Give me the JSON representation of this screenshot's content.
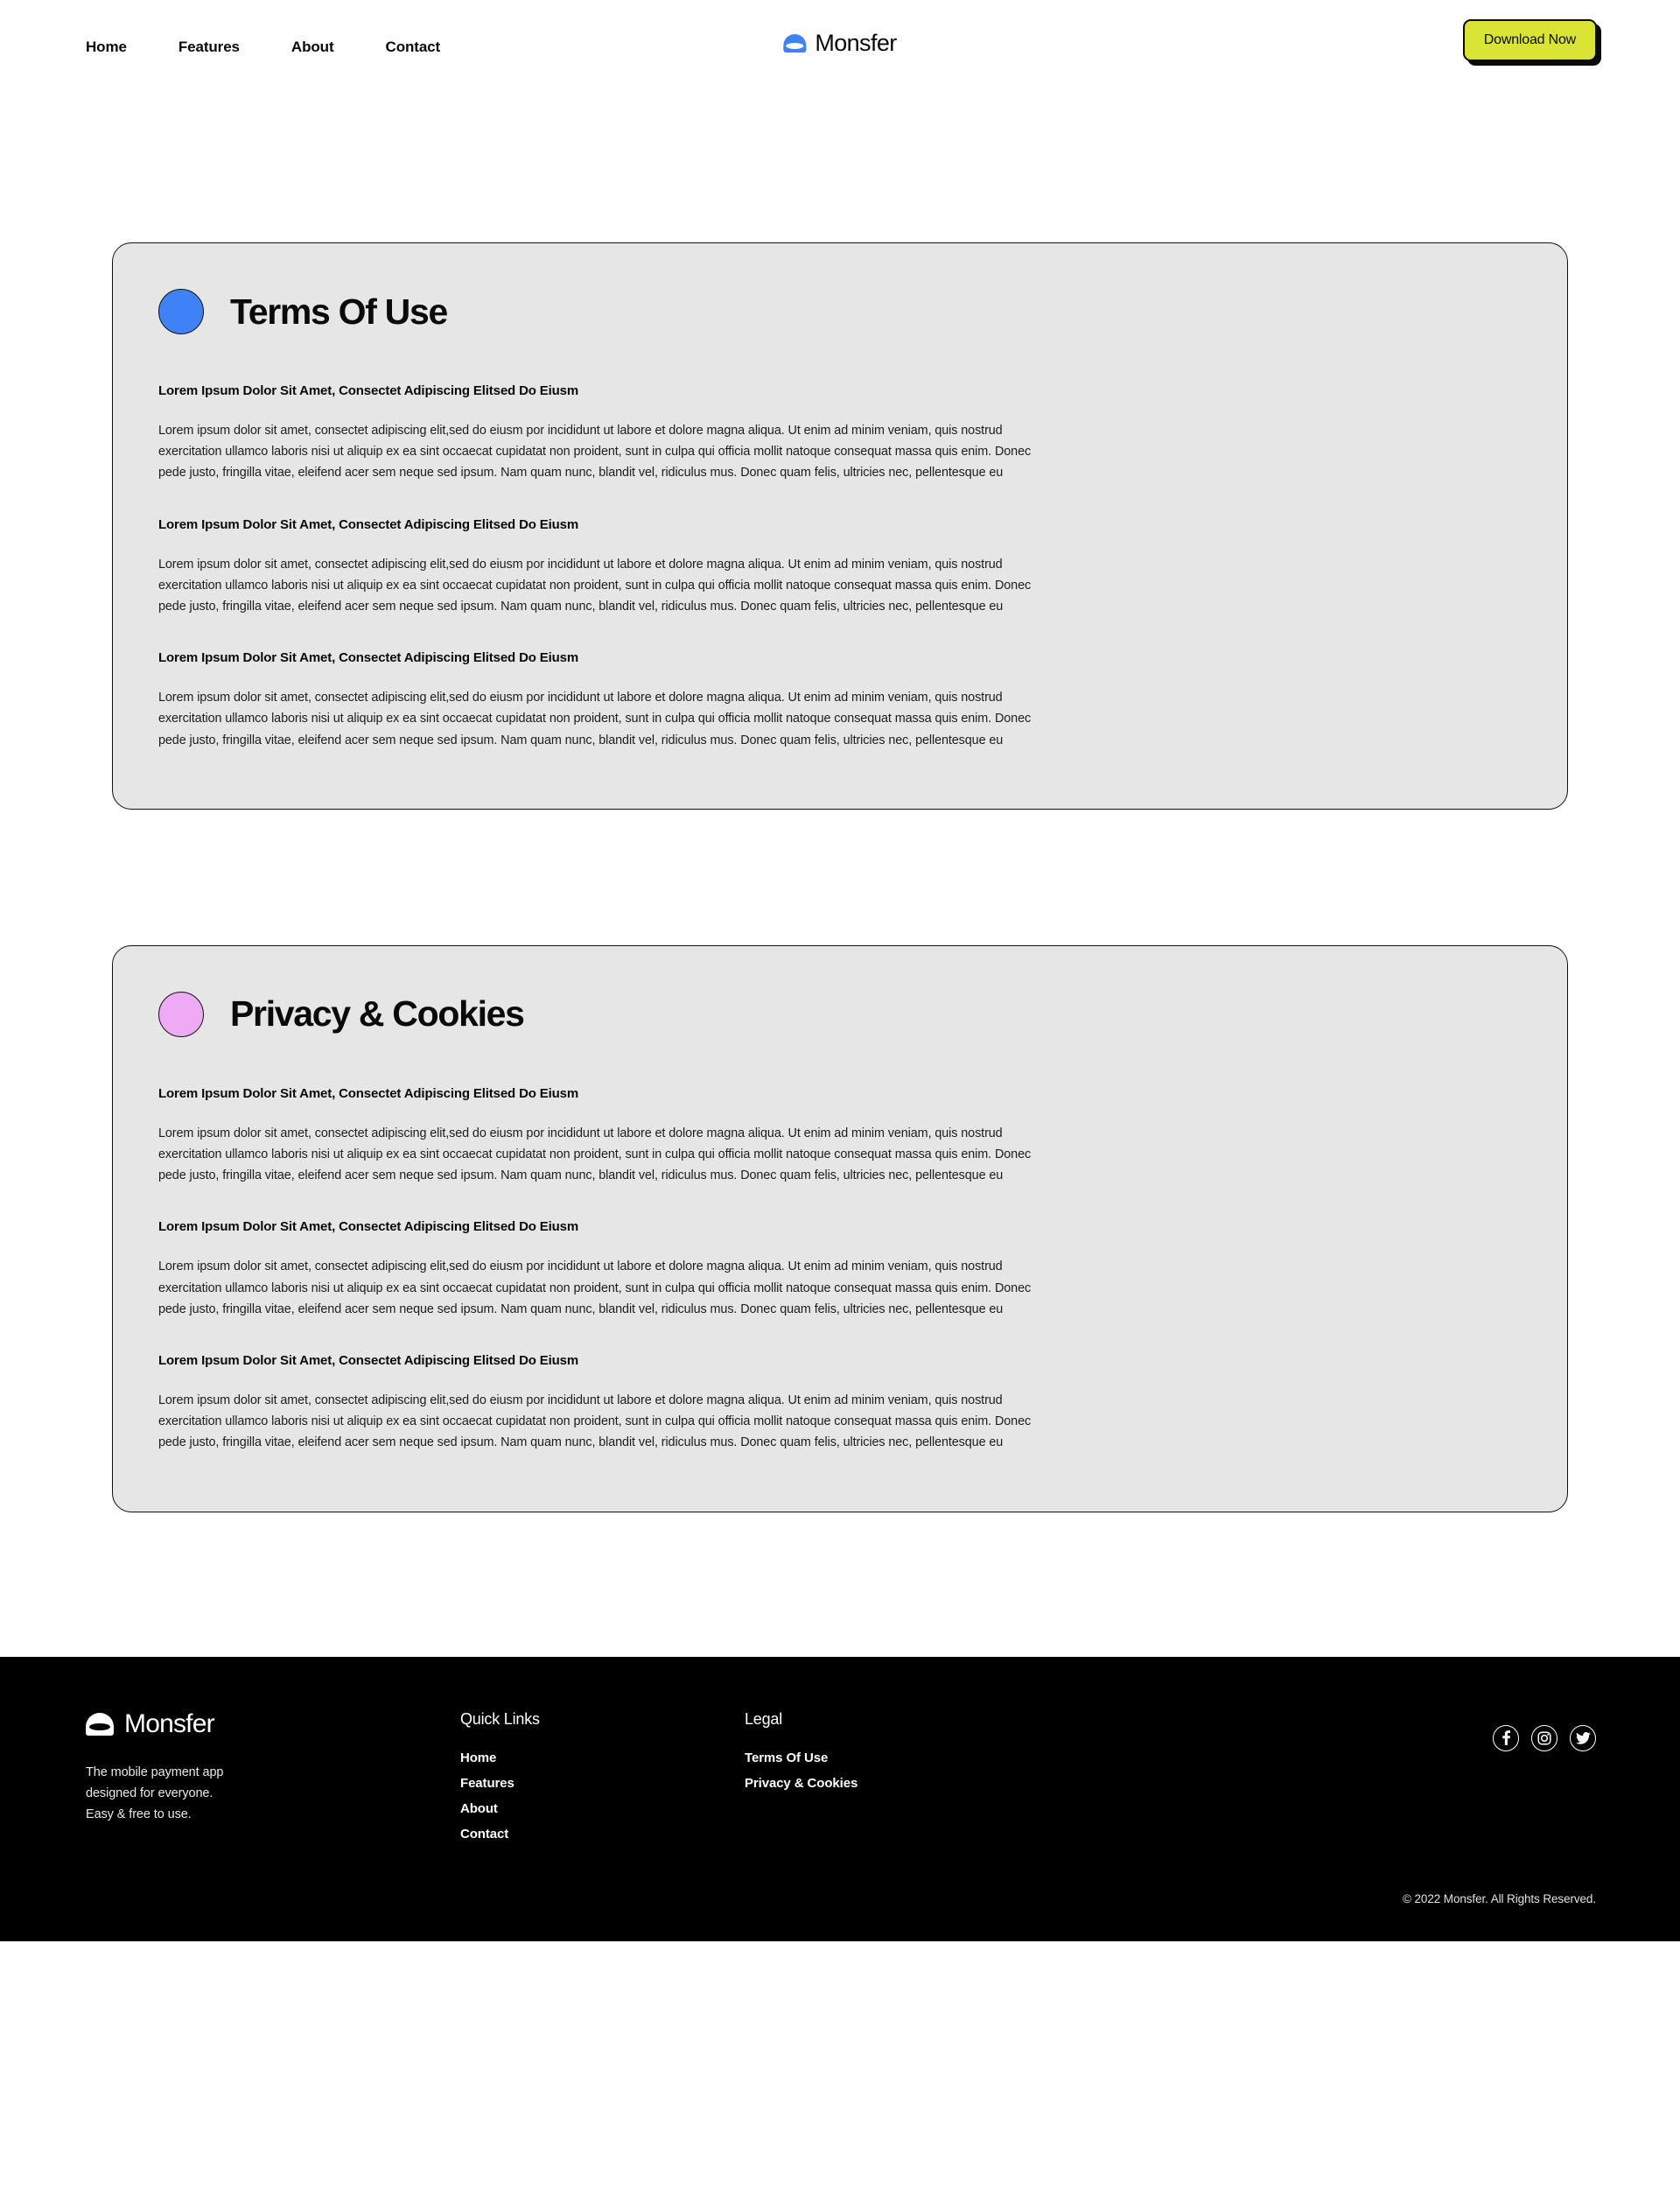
{
  "header": {
    "nav_items": [
      {
        "label": "Home"
      },
      {
        "label": "Features"
      },
      {
        "label": "About"
      },
      {
        "label": "Contact"
      }
    ],
    "brand_name": "Monsfer",
    "logo_icon": "monsfer-dome-logo",
    "cta_label": "Download Now",
    "cta_color": "#d9e434"
  },
  "cards": [
    {
      "title": "Terms Of Use",
      "dot_color": "#3f82f7",
      "blocks": [
        {
          "heading": "Lorem Ipsum Dolor Sit Amet, Consectet Adipiscing Elitsed Do Eiusm",
          "body": "Lorem ipsum dolor sit amet, consectet adipiscing elit,sed do eiusm por incididunt ut labore et dolore magna aliqua. Ut enim ad minim veniam, quis nostrud exercitation ullamco laboris nisi ut aliquip ex ea sint occaecat cupidatat non proident, sunt in culpa qui officia mollit natoque consequat massa quis enim. Donec pede justo, fringilla vitae, eleifend acer sem neque sed ipsum. Nam quam nunc, blandit vel, ridiculus mus. Donec quam felis, ultricies nec, pellentesque eu"
        },
        {
          "heading": "Lorem Ipsum Dolor Sit Amet, Consectet Adipiscing Elitsed Do Eiusm",
          "body": "Lorem ipsum dolor sit amet, consectet adipiscing elit,sed do eiusm por incididunt ut labore et dolore magna aliqua. Ut enim ad minim veniam, quis nostrud exercitation ullamco laboris nisi ut aliquip ex ea sint occaecat cupidatat non proident, sunt in culpa qui officia mollit natoque consequat massa quis enim. Donec pede justo, fringilla vitae, eleifend acer sem neque sed ipsum. Nam quam nunc, blandit vel, ridiculus mus. Donec quam felis, ultricies nec, pellentesque eu"
        },
        {
          "heading": "Lorem Ipsum Dolor Sit Amet, Consectet Adipiscing Elitsed Do Eiusm",
          "body": "Lorem ipsum dolor sit amet, consectet adipiscing elit,sed do eiusm por incididunt ut labore et dolore magna aliqua. Ut enim ad minim veniam, quis nostrud exercitation ullamco laboris nisi ut aliquip ex ea sint occaecat cupidatat non proident, sunt in culpa qui officia mollit natoque consequat massa quis enim. Donec pede justo, fringilla vitae, eleifend acer sem neque sed ipsum. Nam quam nunc, blandit vel, ridiculus mus. Donec quam felis, ultricies nec, pellentesque eu"
        }
      ]
    },
    {
      "title": "Privacy & Cookies",
      "dot_color": "#eeaaf5",
      "blocks": [
        {
          "heading": "Lorem Ipsum Dolor Sit Amet, Consectet Adipiscing Elitsed Do Eiusm",
          "body": "Lorem ipsum dolor sit amet, consectet adipiscing elit,sed do eiusm por incididunt ut labore et dolore magna aliqua. Ut enim ad minim veniam, quis nostrud exercitation ullamco laboris nisi ut aliquip ex ea sint occaecat cupidatat non proident, sunt in culpa qui officia mollit natoque consequat massa quis enim. Donec pede justo, fringilla vitae, eleifend acer sem neque sed ipsum. Nam quam nunc, blandit vel, ridiculus mus. Donec quam felis, ultricies nec, pellentesque eu"
        },
        {
          "heading": "Lorem Ipsum Dolor Sit Amet, Consectet Adipiscing Elitsed Do Eiusm",
          "body": "Lorem ipsum dolor sit amet, consectet adipiscing elit,sed do eiusm por incididunt ut labore et dolore magna aliqua. Ut enim ad minim veniam, quis nostrud exercitation ullamco laboris nisi ut aliquip ex ea sint occaecat cupidatat non proident, sunt in culpa qui officia mollit natoque consequat massa quis enim. Donec pede justo, fringilla vitae, eleifend acer sem neque sed ipsum. Nam quam nunc, blandit vel, ridiculus mus. Donec quam felis, ultricies nec, pellentesque eu"
        },
        {
          "heading": "Lorem Ipsum Dolor Sit Amet, Consectet Adipiscing Elitsed Do Eiusm",
          "body": "Lorem ipsum dolor sit amet, consectet adipiscing elit,sed do eiusm por incididunt ut labore et dolore magna aliqua. Ut enim ad minim veniam, quis nostrud exercitation ullamco laboris nisi ut aliquip ex ea sint occaecat cupidatat non proident, sunt in culpa qui officia mollit natoque consequat massa quis enim. Donec pede justo, fringilla vitae, eleifend acer sem neque sed ipsum. Nam quam nunc, blandit vel, ridiculus mus. Donec quam felis, ultricies nec, pellentesque eu"
        }
      ]
    }
  ],
  "footer": {
    "brand_name": "Monsfer",
    "logo_icon": "monsfer-dome-logo",
    "tagline_line1": "The mobile payment app",
    "tagline_line2": "designed for everyone.",
    "tagline_line3": "Easy & free to use.",
    "quick_links_title": "Quick Links",
    "quick_links": [
      {
        "label": "Home"
      },
      {
        "label": "Features"
      },
      {
        "label": "About"
      },
      {
        "label": "Contact"
      }
    ],
    "legal_title": "Legal",
    "legal_links": [
      {
        "label": "Terms Of Use"
      },
      {
        "label": "Privacy & Cookies"
      }
    ],
    "social": [
      {
        "icon": "facebook-icon"
      },
      {
        "icon": "instagram-icon"
      },
      {
        "icon": "twitter-icon"
      }
    ],
    "copyright": "© 2022 Monsfer. All Rights Reserved."
  }
}
